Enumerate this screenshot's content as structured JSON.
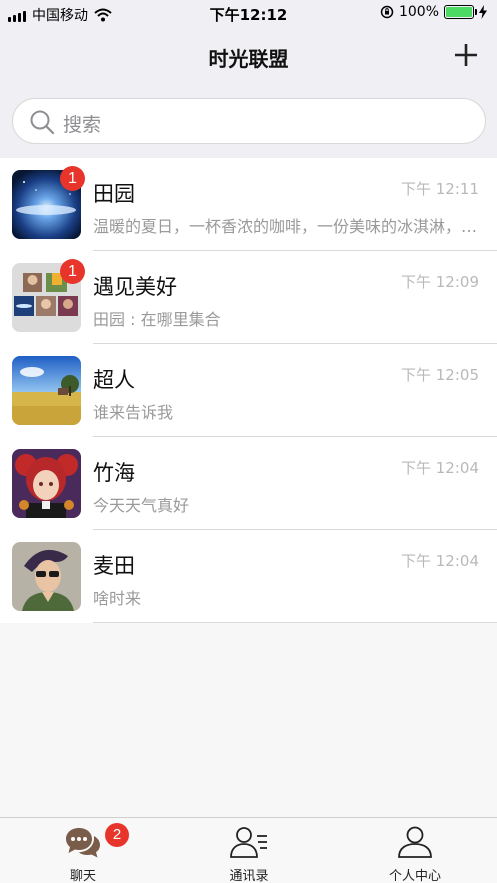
{
  "status_bar": {
    "carrier": "中国移动",
    "time": "下午12:12",
    "battery": "100%"
  },
  "nav": {
    "title": "时光联盟"
  },
  "search": {
    "placeholder": "搜索"
  },
  "chats": [
    {
      "name": "田园",
      "time": "下午 12:11",
      "message": "温暖的夏日，一杯香浓的咖啡，一份美味的冰淇淋，一…",
      "badge": "1",
      "avatar": "galaxy-avatar"
    },
    {
      "name": "遇见美好",
      "time": "下午 12:09",
      "message": "田园 : 在哪里集合",
      "badge": "1",
      "avatar": "group-avatar"
    },
    {
      "name": "超人",
      "time": "下午 12:05",
      "message": "谁来告诉我",
      "badge": "",
      "avatar": "field-avatar"
    },
    {
      "name": "竹海",
      "time": "下午 12:04",
      "message": "今天天气真好",
      "badge": "",
      "avatar": "anime-girl-avatar"
    },
    {
      "name": "麦田",
      "time": "下午 12:04",
      "message": "啥时来",
      "badge": "",
      "avatar": "anime-boy-avatar"
    }
  ],
  "tabbar": {
    "tabs": [
      {
        "label": "聊天",
        "badge": "2",
        "icon": "chat-bubbles-icon"
      },
      {
        "label": "通讯录",
        "icon": "contacts-icon"
      },
      {
        "label": "个人中心",
        "icon": "person-icon"
      }
    ]
  },
  "colors": {
    "badge": "#e8352b",
    "active_tab": "#7a5c4a",
    "battery": "#4cd964"
  }
}
